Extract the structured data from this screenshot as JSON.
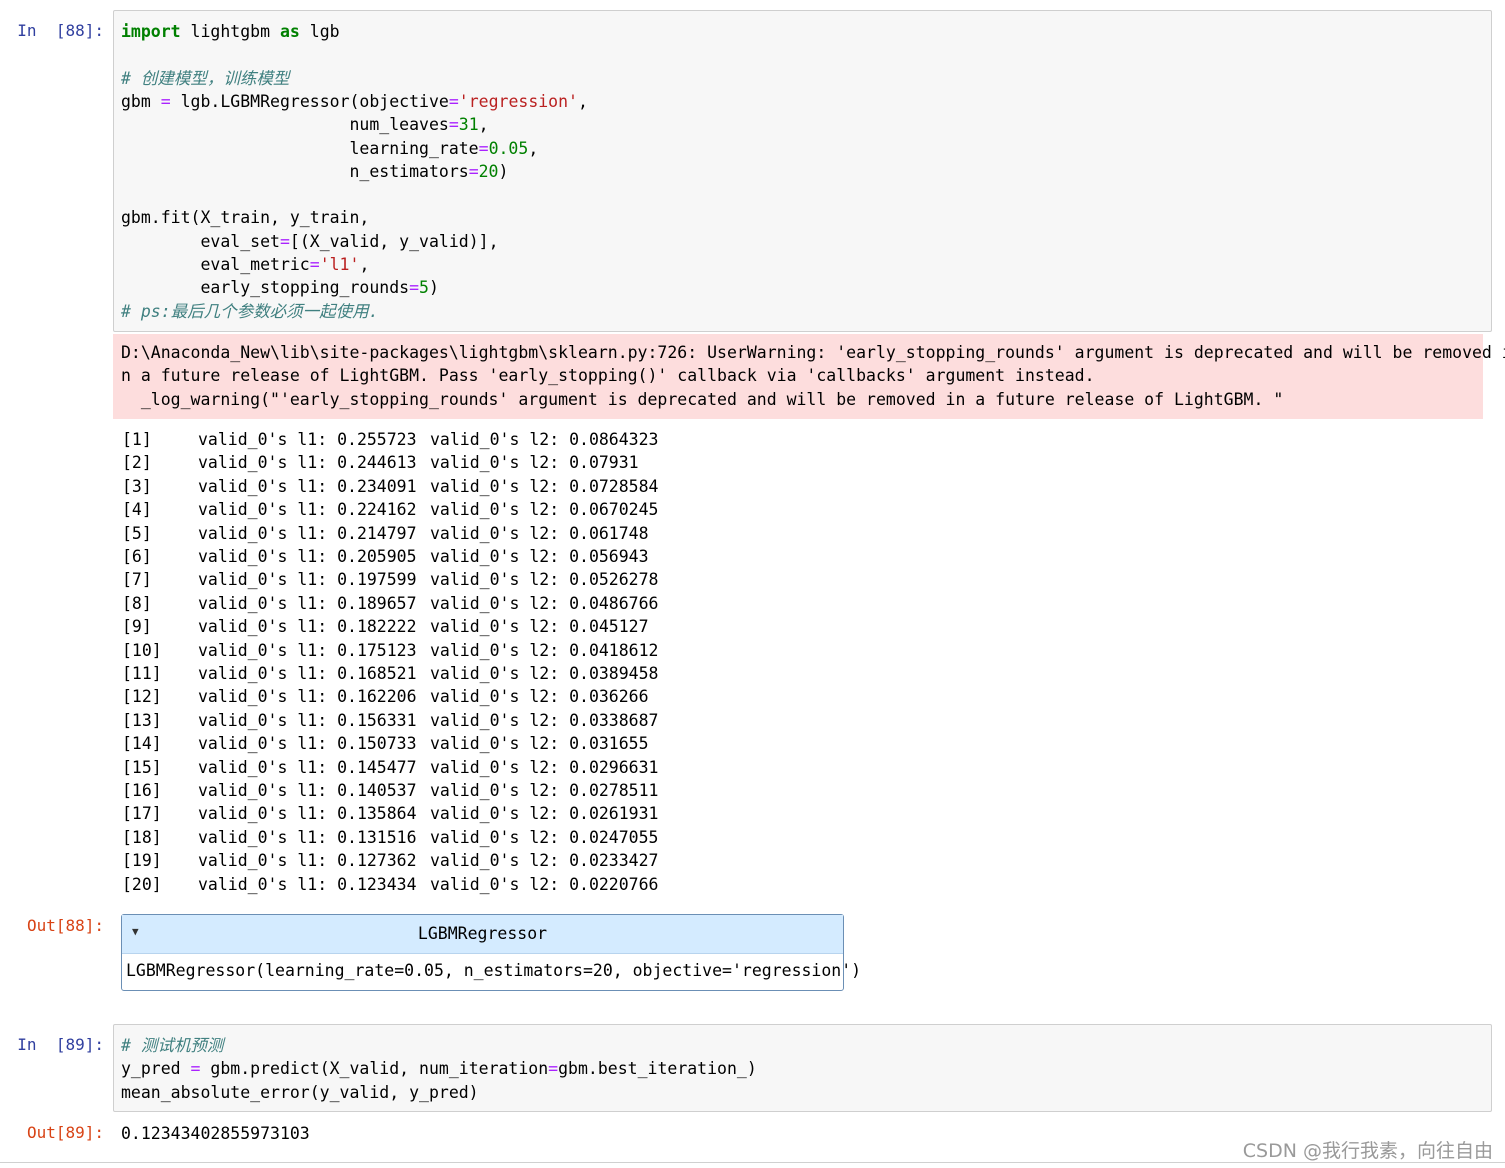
{
  "cells": [
    {
      "in_prompt": "In  [88]:",
      "code": [
        [
          [
            "kw",
            "import"
          ],
          [
            "",
            "lightgbm"
          ],
          [
            "kw",
            "as"
          ],
          [
            "",
            "lgb"
          ]
        ],
        [],
        [
          [
            "cm",
            "# 创建模型，训练模型"
          ]
        ],
        [
          [
            "",
            "gbm "
          ],
          [
            "op",
            "="
          ],
          [
            "",
            "",
            " lgb.LGBMRegressor(objective"
          ],
          [
            "op",
            "="
          ],
          [
            "st",
            "'regression'"
          ],
          [
            "",
            ","
          ]
        ],
        [
          [
            "",
            "                       num_leaves"
          ],
          [
            "op",
            "="
          ],
          [
            "nm",
            "31"
          ],
          [
            "",
            ","
          ]
        ],
        [
          [
            "",
            "                       learning_rate"
          ],
          [
            "op",
            "="
          ],
          [
            "nm",
            "0.05"
          ],
          [
            "",
            ","
          ]
        ],
        [
          [
            "",
            "                       n_estimators"
          ],
          [
            "op",
            "="
          ],
          [
            "nm",
            "20"
          ],
          [
            "",
            ")"
          ]
        ],
        [],
        [
          [
            "",
            "gbm.fit(X_train, y_train,"
          ]
        ],
        [
          [
            "",
            "        eval_set"
          ],
          [
            "op",
            "="
          ],
          [
            "",
            "[(X_valid, y_valid)],"
          ]
        ],
        [
          [
            "",
            "        eval_metric"
          ],
          [
            "op",
            "="
          ],
          [
            "st",
            "'l1'"
          ],
          [
            "",
            ","
          ]
        ],
        [
          [
            "",
            "        early_stopping_rounds"
          ],
          [
            "op",
            "="
          ],
          [
            "nm",
            "5"
          ],
          [
            "",
            ")"
          ]
        ],
        [
          [
            "cm",
            "# ps:最后几个参数必须一起使用."
          ]
        ]
      ],
      "stderr": [
        "D:\\Anaconda_New\\lib\\site-packages\\lightgbm\\sklearn.py:726: UserWarning: 'early_stopping_rounds' argument is deprecated and will be removed i",
        "n a future release of LightGBM. Pass 'early_stopping()' callback via 'callbacks' argument instead.",
        "  _log_warning(\"'early_stopping_rounds' argument is deprecated and will be removed in a future release of LightGBM. \""
      ],
      "stdout": [
        "[1]\tvalid_0's l1: 0.255723\tvalid_0's l2: 0.0864323",
        "[2]\tvalid_0's l1: 0.244613\tvalid_0's l2: 0.07931",
        "[3]\tvalid_0's l1: 0.234091\tvalid_0's l2: 0.0728584",
        "[4]\tvalid_0's l1: 0.224162\tvalid_0's l2: 0.0670245",
        "[5]\tvalid_0's l1: 0.214797\tvalid_0's l2: 0.061748",
        "[6]\tvalid_0's l1: 0.205905\tvalid_0's l2: 0.056943",
        "[7]\tvalid_0's l1: 0.197599\tvalid_0's l2: 0.0526278",
        "[8]\tvalid_0's l1: 0.189657\tvalid_0's l2: 0.0486766",
        "[9]\tvalid_0's l1: 0.182222\tvalid_0's l2: 0.045127",
        "[10]\tvalid_0's l1: 0.175123\tvalid_0's l2: 0.0418612",
        "[11]\tvalid_0's l1: 0.168521\tvalid_0's l2: 0.0389458",
        "[12]\tvalid_0's l1: 0.162206\tvalid_0's l2: 0.036266",
        "[13]\tvalid_0's l1: 0.156331\tvalid_0's l2: 0.0338687",
        "[14]\tvalid_0's l1: 0.150733\tvalid_0's l2: 0.031655",
        "[15]\tvalid_0's l1: 0.145477\tvalid_0's l2: 0.0296631",
        "[16]\tvalid_0's l1: 0.140537\tvalid_0's l2: 0.0278511",
        "[17]\tvalid_0's l1: 0.135864\tvalid_0's l2: 0.0261931",
        "[18]\tvalid_0's l1: 0.131516\tvalid_0's l2: 0.0247055",
        "[19]\tvalid_0's l1: 0.127362\tvalid_0's l2: 0.0233427",
        "[20]\tvalid_0's l1: 0.123434\tvalid_0's l2: 0.0220766"
      ],
      "out_prompt": "Out[88]:",
      "widget": {
        "title": "LGBMRegressor",
        "body": "LGBMRegressor(learning_rate=0.05, n_estimators=20, objective='regression')",
        "toggle_icon": "triangle-down-icon"
      }
    },
    {
      "in_prompt": "In  [89]:",
      "code": [
        [
          [
            "cm",
            "# 测试机预测"
          ]
        ],
        [
          [
            "",
            "y_pred "
          ],
          [
            "op",
            "="
          ],
          [
            "",
            "",
            " gbm.predict(X_valid, num_iteration"
          ],
          [
            "op",
            "="
          ],
          [
            "",
            "gbm.best_iteration_)"
          ]
        ],
        [
          [
            "",
            "mean_absolute_error(y_valid, y_pred)"
          ]
        ]
      ],
      "out_prompt": "Out[89]:",
      "result": "0.12343402855973103"
    }
  ],
  "watermark": "CSDN @我行我素，向往自由",
  "colors": {
    "keyword": "#008000",
    "comment": "#408080",
    "string": "#ba2121",
    "number": "#008000",
    "operator": "#aa22ff",
    "in_prompt": "#303f9f",
    "out_prompt": "#d84315",
    "stderr_bg": "#fddddd"
  }
}
